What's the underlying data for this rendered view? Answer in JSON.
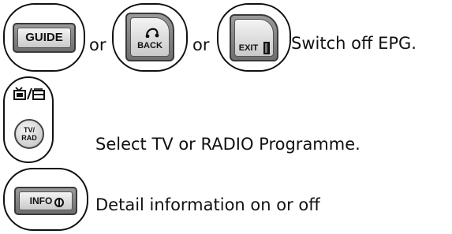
{
  "row1": {
    "guide_key_label": "GUIDE",
    "or_1": "or",
    "back_key_label": "BACK",
    "or_2": "or",
    "exit_key_label": "EXIT",
    "description": "Switch off EPG."
  },
  "row2": {
    "tv_radio_top_icon": "tv-radio-icon",
    "tv_radio_key_line1": "TV/",
    "tv_radio_key_line2": "RAD",
    "description": "Select TV or RADIO Programme."
  },
  "row3": {
    "info_key_label": "INFO",
    "description": "Detail information on or off"
  }
}
